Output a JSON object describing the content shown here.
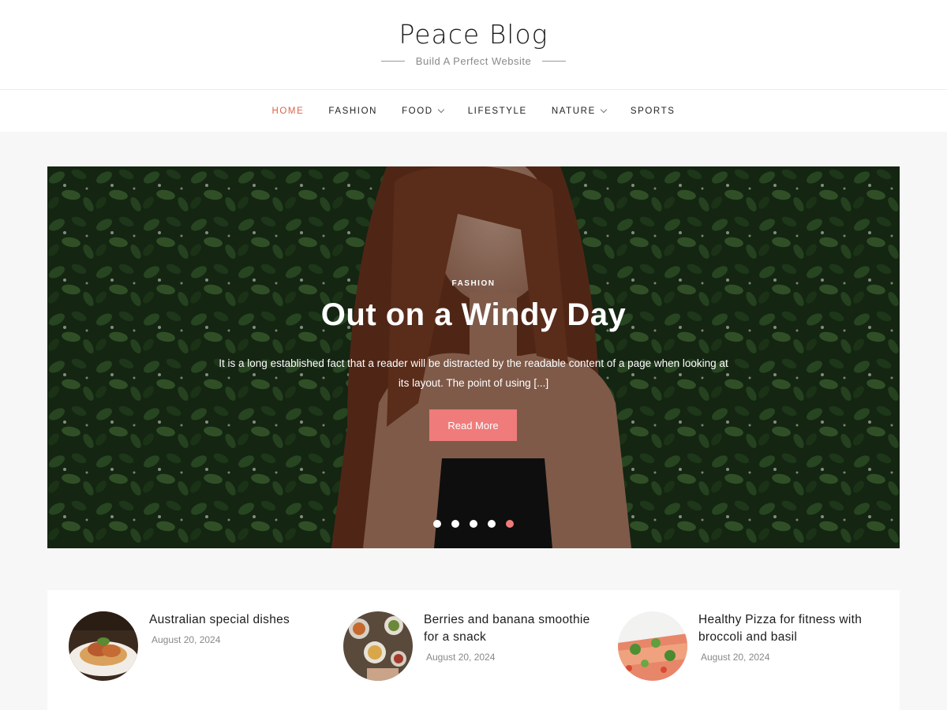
{
  "header": {
    "site_title": "Peace Blog",
    "tagline": "Build A Perfect Website"
  },
  "nav": {
    "items": [
      {
        "label": "HOME",
        "active": true,
        "has_dropdown": false
      },
      {
        "label": "FASHION",
        "active": false,
        "has_dropdown": false
      },
      {
        "label": "FOOD",
        "active": false,
        "has_dropdown": true
      },
      {
        "label": "LIFESTYLE",
        "active": false,
        "has_dropdown": false
      },
      {
        "label": "NATURE",
        "active": false,
        "has_dropdown": true
      },
      {
        "label": "SPORTS",
        "active": false,
        "has_dropdown": false
      }
    ]
  },
  "slider": {
    "category": "FASHION",
    "title": "Out on a Windy Day",
    "excerpt": "It is a long established fact that a reader will be distracted by the readable content of a page when looking at its layout. The point of using [...]",
    "button_label": "Read More",
    "slide_count": 5,
    "active_slide": 5
  },
  "posts": [
    {
      "title": "Australian special dishes",
      "date": "August 20, 2024",
      "thumb": "food-plate-photo"
    },
    {
      "title": "Berries and banana smoothie for a snack",
      "date": "August 20, 2024",
      "thumb": "table-food-photo"
    },
    {
      "title": "Healthy Pizza for fitness with broccoli and basil",
      "date": "August 20, 2024",
      "thumb": "pizza-photo"
    }
  ],
  "colors": {
    "accent": "#ef7b7b",
    "nav_active": "#d9634c",
    "page_bg": "#f7f7f7"
  }
}
